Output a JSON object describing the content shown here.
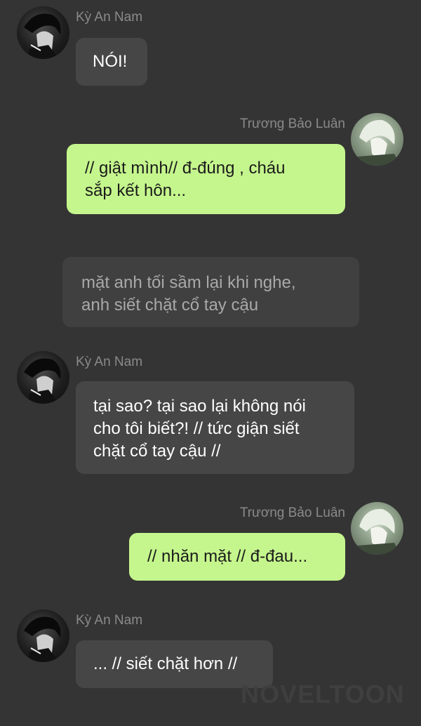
{
  "messages": [
    {
      "sender": "Kỳ An Nam",
      "side": "left",
      "text": "NÓI!"
    },
    {
      "sender": "Trương Bảo Luân",
      "side": "right",
      "text": "// giật mình// đ-đúng , cháu\nsắp kết hôn..."
    },
    {
      "sender": "",
      "side": "narration",
      "text": "mặt anh tối sầm lại khi nghe,\nanh siết chặt cổ tay cậu"
    },
    {
      "sender": "Kỳ An Nam",
      "side": "left",
      "text": "tại sao? tại sao lại không nói\ncho tôi biết?! // tức giận siết\nchặt cổ tay cậu //"
    },
    {
      "sender": "Trương Bảo Luân",
      "side": "right",
      "text": "// nhăn mặt // đ-đau..."
    },
    {
      "sender": "Kỳ An Nam",
      "side": "left",
      "text": "... // siết chặt hơn //"
    }
  ],
  "watermark": "NOVELTOON",
  "colors": {
    "background": "#343434",
    "incoming": "#464646",
    "outgoing": "#c5f68d",
    "narration": "#404040"
  }
}
